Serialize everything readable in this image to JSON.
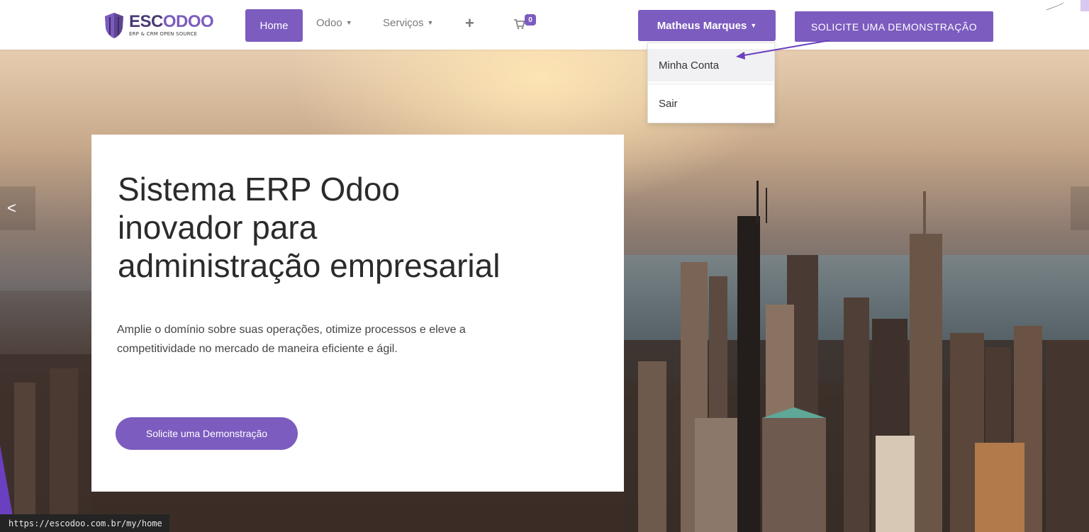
{
  "brand": {
    "name_part1": "ESC",
    "name_part2": "ODOO",
    "tagline": "ERP & CRM OPEN SOURCE",
    "colors": {
      "primary": "#7c5cbf",
      "dark": "#4b3a74"
    }
  },
  "nav": {
    "home_label": "Home",
    "odoo_label": "Odoo",
    "servicos_label": "Serviços",
    "plus_label": "+",
    "cart_count": "0",
    "user_label": "Matheus Marques",
    "cta_label": "SOLICITE UMA DEMONSTRAÇÃO"
  },
  "user_menu": {
    "items": [
      "Minha Conta",
      "Sair"
    ]
  },
  "hero": {
    "title_line1": "Sistema ERP Odoo",
    "title_line2": "inovador para",
    "title_line3": "administração empresarial",
    "text_line1": "Amplie o domínio sobre suas operações, otimize processos e eleve a",
    "text_line2": "competitividade no mercado de maneira eficiente e ágil.",
    "cta_label": "Solicite uma Demonstração"
  },
  "carousel": {
    "prev_icon": "<"
  },
  "status_bar": {
    "url": "https://escodoo.com.br/my/home"
  }
}
